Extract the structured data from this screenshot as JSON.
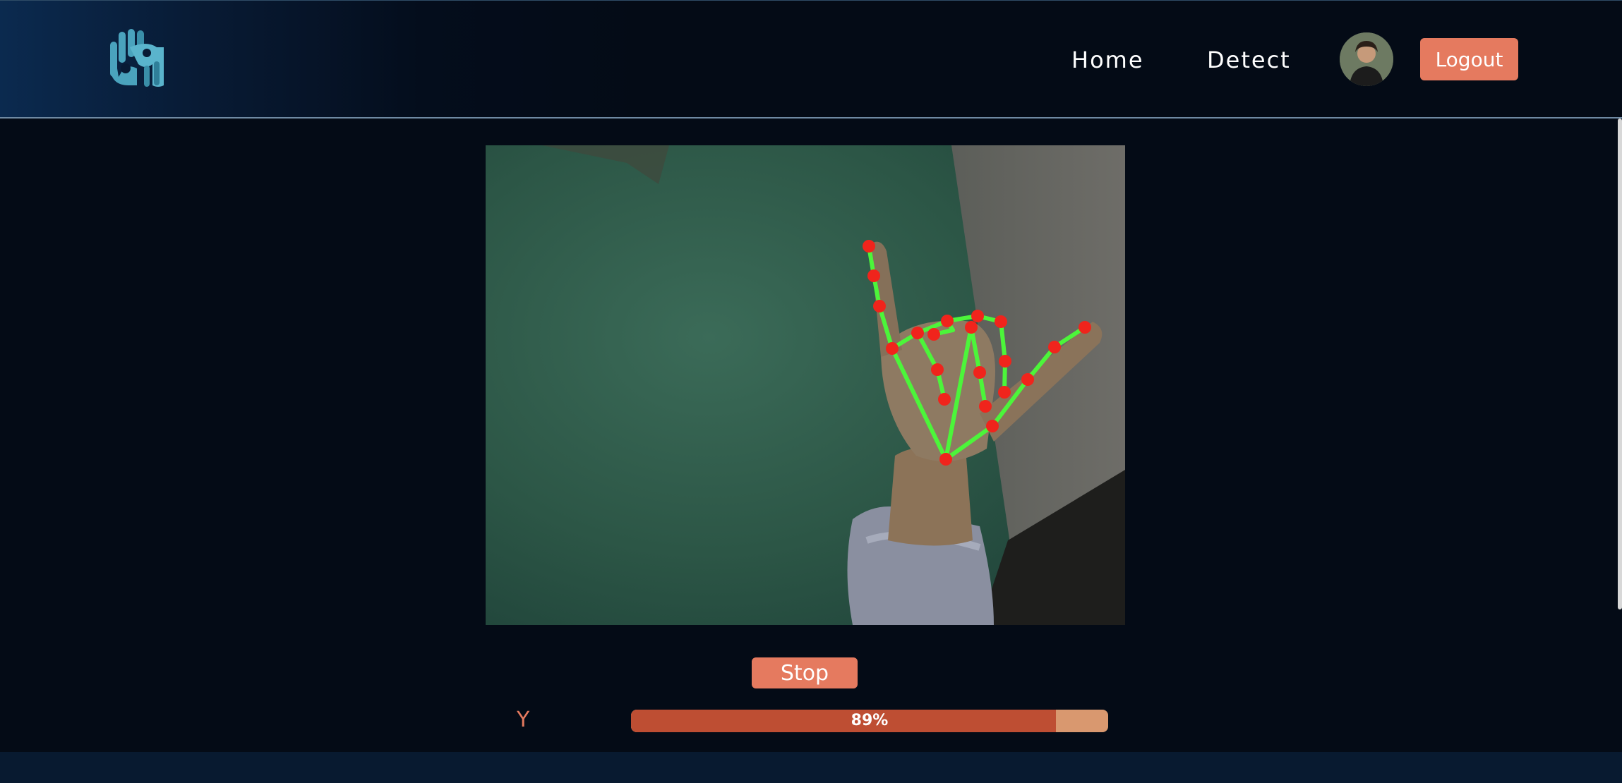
{
  "header": {
    "logo_icon": "hands-logo-icon",
    "nav": [
      {
        "label": "Home"
      },
      {
        "label": "Detect"
      }
    ],
    "avatar_icon": "user-avatar",
    "logout_label": "Logout"
  },
  "detection": {
    "stop_label": "Stop",
    "predicted_letter": "Y",
    "confidence": 0.89,
    "confidence_text": "89%"
  },
  "colors": {
    "accent": "#e57a5f",
    "bar_fill": "#be4e33",
    "bar_track": "#d9986f",
    "landmark": "#f0241c",
    "connection": "#4cf53a",
    "background": "#040b16"
  }
}
